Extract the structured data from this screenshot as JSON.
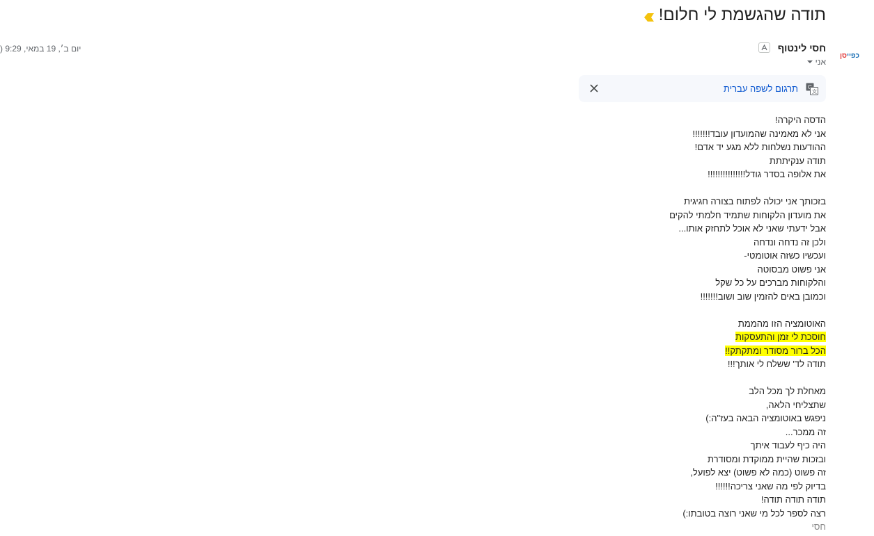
{
  "email": {
    "subject": "תודה שהגשמת לי חלום!",
    "sender": {
      "name": "חסי לינטוף",
      "avatar_text_blue": "כפיי",
      "avatar_text_red": "סן"
    },
    "recipient_label": "אני",
    "datetime": "יום ב׳, 19 במאי, 9:29 (",
    "translate": {
      "link_label": "תרגום לשפה עברית"
    },
    "body": {
      "para1": [
        "הדסה היקרה!",
        "אני לא מאמינה שהמועדון עובד!!!!!!!",
        "ההודעות נשלחות ללא מגע יד אדם!",
        "תודה ענקיתתת",
        "את אלופה בסדר גודל!!!!!!!!!!!!!!!"
      ],
      "para2": [
        "בזכותך אני יכולה לפתוח בצורה חגיגית",
        "את מועדון הלקוחות שתמיד חלמתי להקים",
        "אבל ידעתי שאני לא אוכל לתחזק אותו...",
        "ולכן זה נדחה ונדחה",
        "ועכשיו כשזה אוטומטי-",
        "אני פשוט מבסוטה",
        "והלקוחות מברכים על כל שקל",
        "וכמובן באים להזמין שוב ושוב!!!!!!!"
      ],
      "para3": [
        "האוטומציה הזו מהממת"
      ],
      "para3_highlight": [
        "חוסכת לי זמן והתעסקות",
        "הכל ברור מסודר ומתקתק!!"
      ],
      "para3_end": [
        "תודה לד' ששלח לי אותך!!!"
      ],
      "para4": [
        "מאחלת לך מכל הלב",
        "שתצליחי הלאה,",
        "ניפגש באוטומציה הבאה בעז\"ה:)",
        "זה ממכר...",
        "היה כיף לעבוד איתך",
        "ובזכות שהיית ממוקדת ומסודרת",
        "זה פשוט (כמה לא פשוט) יצא לפועל,",
        "בדיוק לפי מה שאני צריכה!!!!!!",
        "תודה תודה תודה!",
        "רצה לספר לכל מי שאני רוצה בטובתו:)"
      ],
      "signature": "חסי"
    }
  },
  "colors": {
    "link": "#0b57d0",
    "highlight": "#ffff00",
    "important_marker": "#f4c20d"
  },
  "icons": {
    "important": "important-marker-icon",
    "translate": "translate-icon",
    "close": "close-icon"
  }
}
